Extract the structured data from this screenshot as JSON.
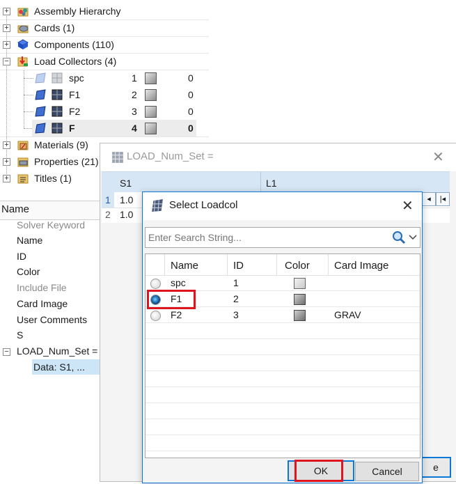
{
  "tree": {
    "items": [
      {
        "label": "Assembly Hierarchy",
        "icon": "assembly-icon"
      },
      {
        "label": "Cards (1)",
        "icon": "cards-icon"
      },
      {
        "label": "Components (110)",
        "icon": "components-icon"
      },
      {
        "label": "Load Collectors (4)",
        "icon": "load-collectors-icon"
      },
      {
        "label": "Materials (9)",
        "icon": "materials-icon"
      },
      {
        "label": "Properties (21)",
        "icon": "properties-icon"
      },
      {
        "label": "Titles (1)",
        "icon": "titles-icon"
      }
    ],
    "expand_plus": "+",
    "expand_minus": "−",
    "load_collectors": [
      {
        "name": "spc",
        "id": "1",
        "value": "0"
      },
      {
        "name": "F1",
        "id": "2",
        "value": "0"
      },
      {
        "name": "F2",
        "id": "3",
        "value": "0"
      },
      {
        "name": "F",
        "id": "4",
        "value": "0"
      }
    ]
  },
  "properties": {
    "header": "Name",
    "rows": [
      "Solver Keyword",
      "Name",
      "ID",
      "Color",
      "Include File",
      "Card Image",
      "User Comments",
      "S",
      "LOAD_Num_Set ="
    ],
    "data_cell": "Data: S1, ..."
  },
  "load_num_set_dialog": {
    "title": "LOAD_Num_Set =",
    "columns": [
      "S1",
      "L1"
    ],
    "rows": [
      {
        "index": "1",
        "s1": "1.0"
      },
      {
        "index": "2",
        "s1": "1.0"
      }
    ],
    "button_partial": "e"
  },
  "select_loadcol_dialog": {
    "title": "Select Loadcol",
    "search_placeholder": "Enter Search String...",
    "columns": [
      "Name",
      "ID",
      "Color",
      "Card Image"
    ],
    "rows": [
      {
        "name": "spc",
        "id": "1",
        "card_image": "",
        "selected": false
      },
      {
        "name": "F1",
        "id": "2",
        "card_image": "",
        "selected": true
      },
      {
        "name": "F2",
        "id": "3",
        "card_image": "GRAV",
        "selected": false
      }
    ],
    "ok_label": "OK",
    "cancel_label": "Cancel"
  },
  "colors": {
    "highlight_red": "#e0141e",
    "accent_blue": "#0a78d7",
    "selection_blue": "#cde6f7"
  }
}
